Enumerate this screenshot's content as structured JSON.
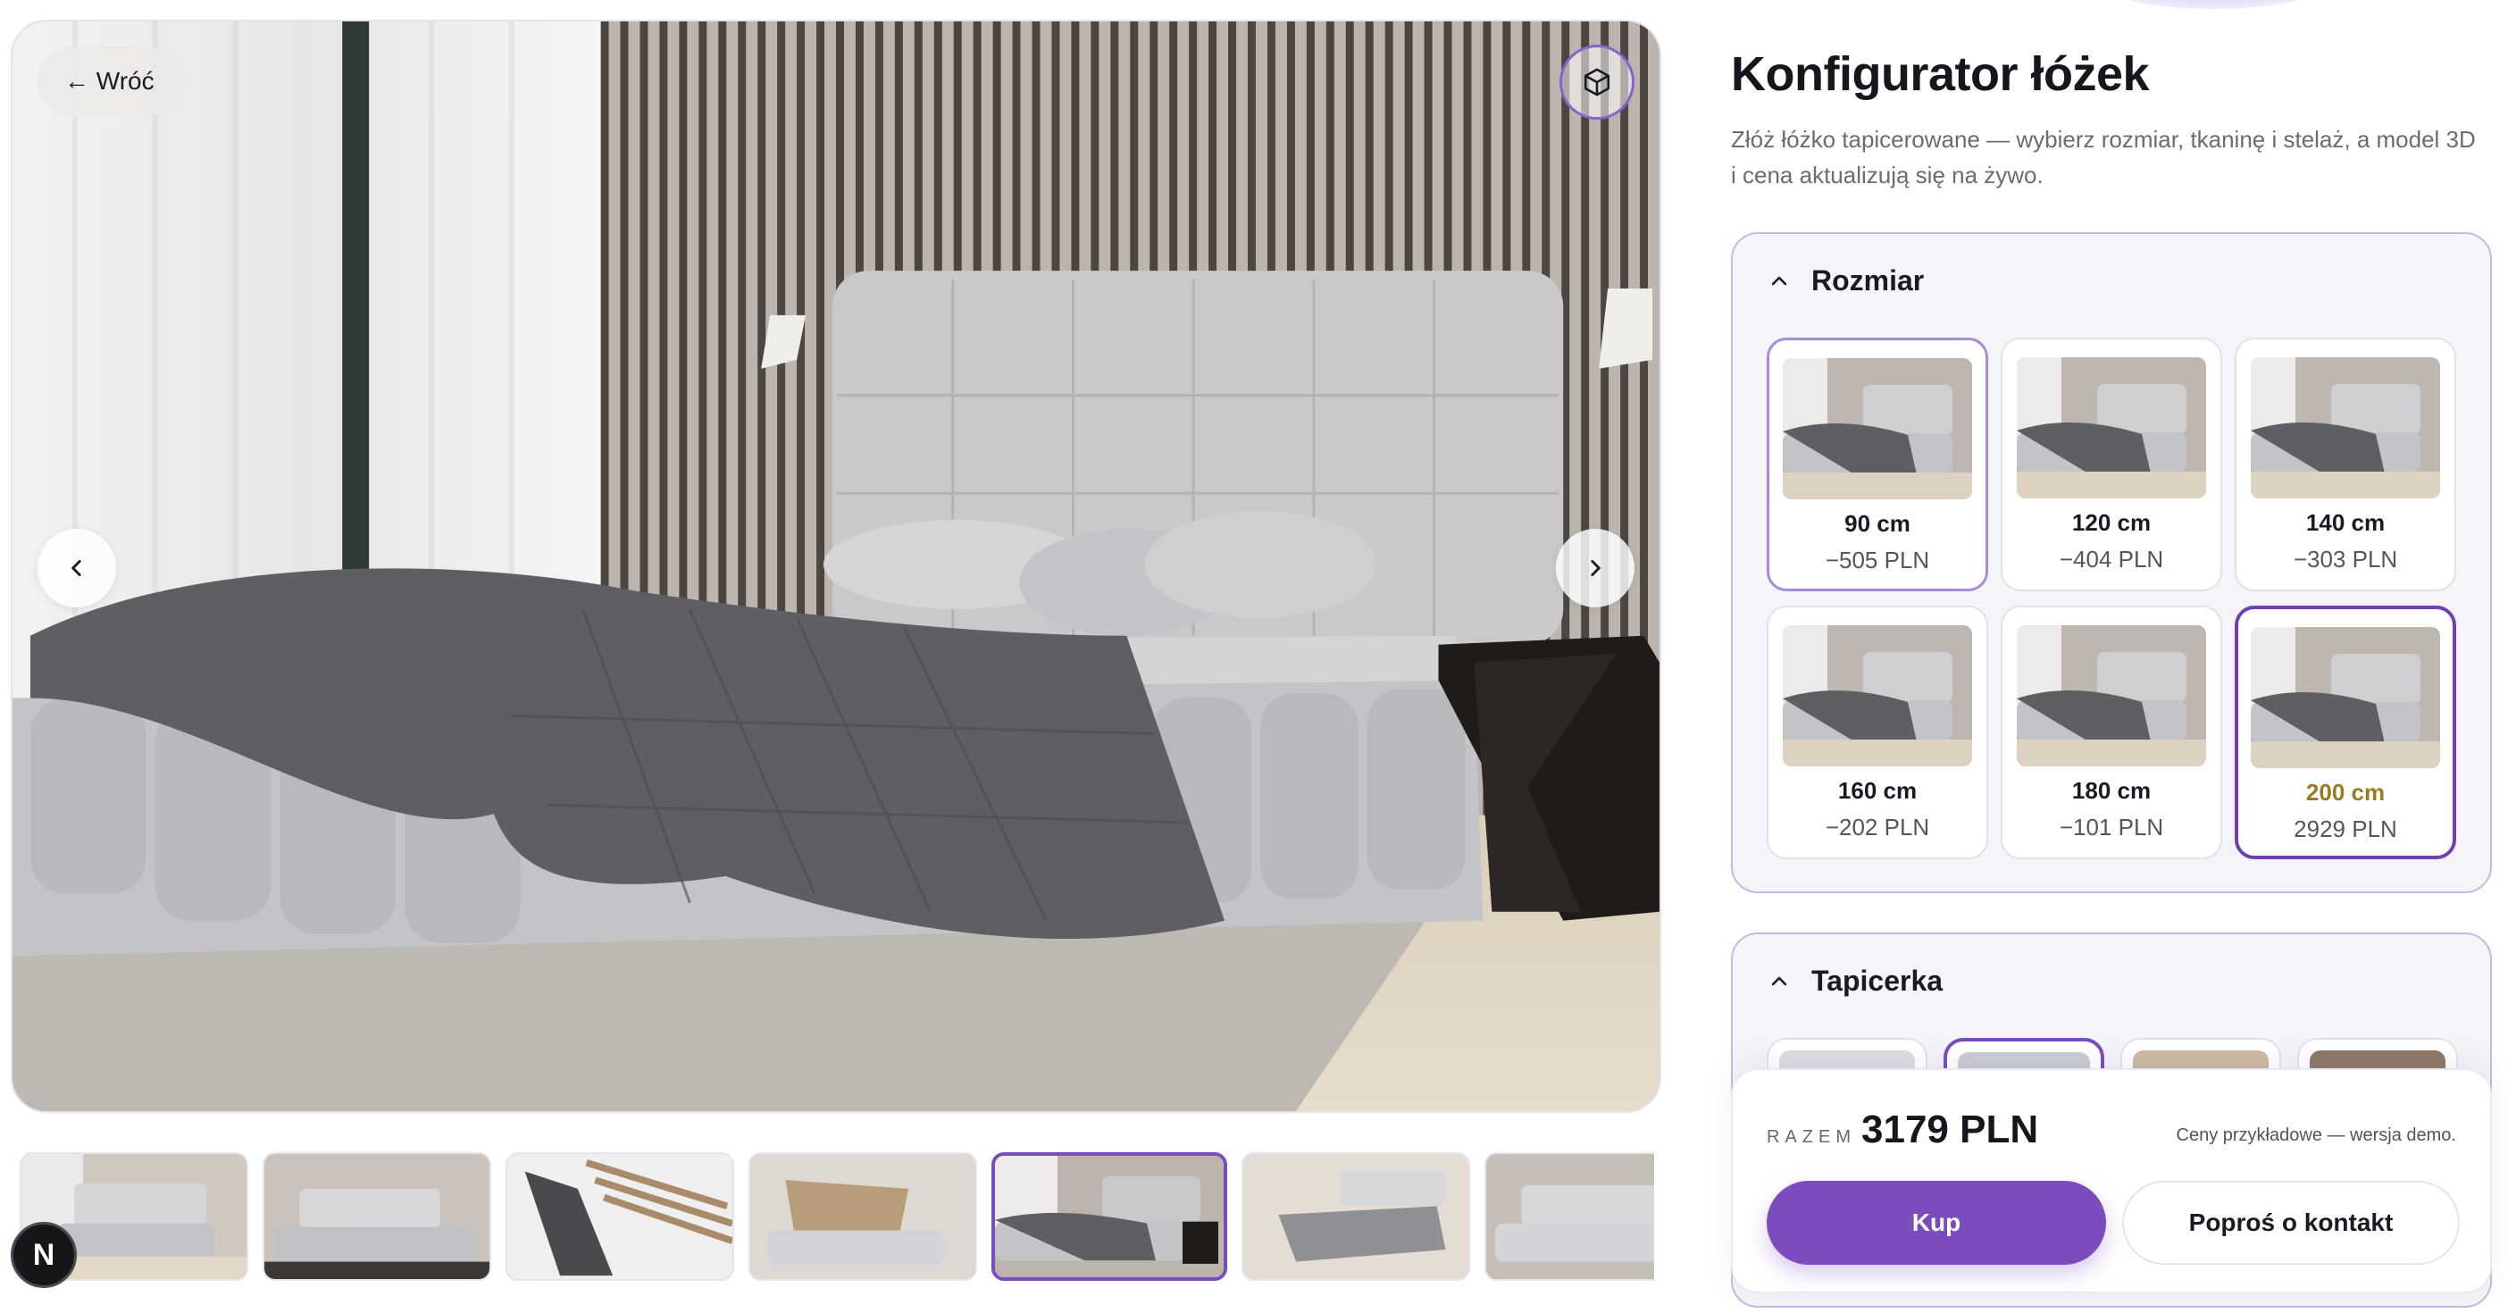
{
  "viewer": {
    "back_label": "← Wróć",
    "ar_icon": "cube-icon",
    "prev_icon": "chevron-left-icon",
    "next_icon": "chevron-right-icon"
  },
  "thumbnails": [
    {
      "name": "thumb-1"
    },
    {
      "name": "thumb-2"
    },
    {
      "name": "thumb-3"
    },
    {
      "name": "thumb-4"
    },
    {
      "name": "thumb-5",
      "active": true
    },
    {
      "name": "thumb-6"
    },
    {
      "name": "thumb-7"
    }
  ],
  "badge": {
    "letter": "N"
  },
  "config": {
    "title": "Konfigurator łóżek",
    "subtitle": "Złóż łóżko tapicerowane — wybierz rozmiar, tkaninę i stelaż, a model 3D i cena aktualizują się na żywo."
  },
  "size_section": {
    "title": "Rozmiar",
    "options": [
      {
        "label": "90 cm",
        "price": "−505 PLN"
      },
      {
        "label": "120 cm",
        "price": "−404 PLN"
      },
      {
        "label": "140 cm",
        "price": "−303 PLN"
      },
      {
        "label": "160 cm",
        "price": "−202 PLN"
      },
      {
        "label": "180 cm",
        "price": "−101 PLN"
      },
      {
        "label": "200 cm",
        "price": "2929 PLN",
        "selected": true
      }
    ]
  },
  "upholstery_section": {
    "title": "Tapicerka",
    "swatch_colors": [
      "#dcdce0",
      "#c9ccd2",
      "#cbb9a2",
      "#8e7a66"
    ]
  },
  "summary": {
    "total_label": "RAZEM",
    "total_amount": "3179 PLN",
    "note": "Ceny przykładowe — wersja demo.",
    "buy_label": "Kup",
    "contact_label": "Poproś o kontakt"
  },
  "colors": {
    "accent": "#7a4cbc",
    "selected_text": "#9a7a22"
  }
}
